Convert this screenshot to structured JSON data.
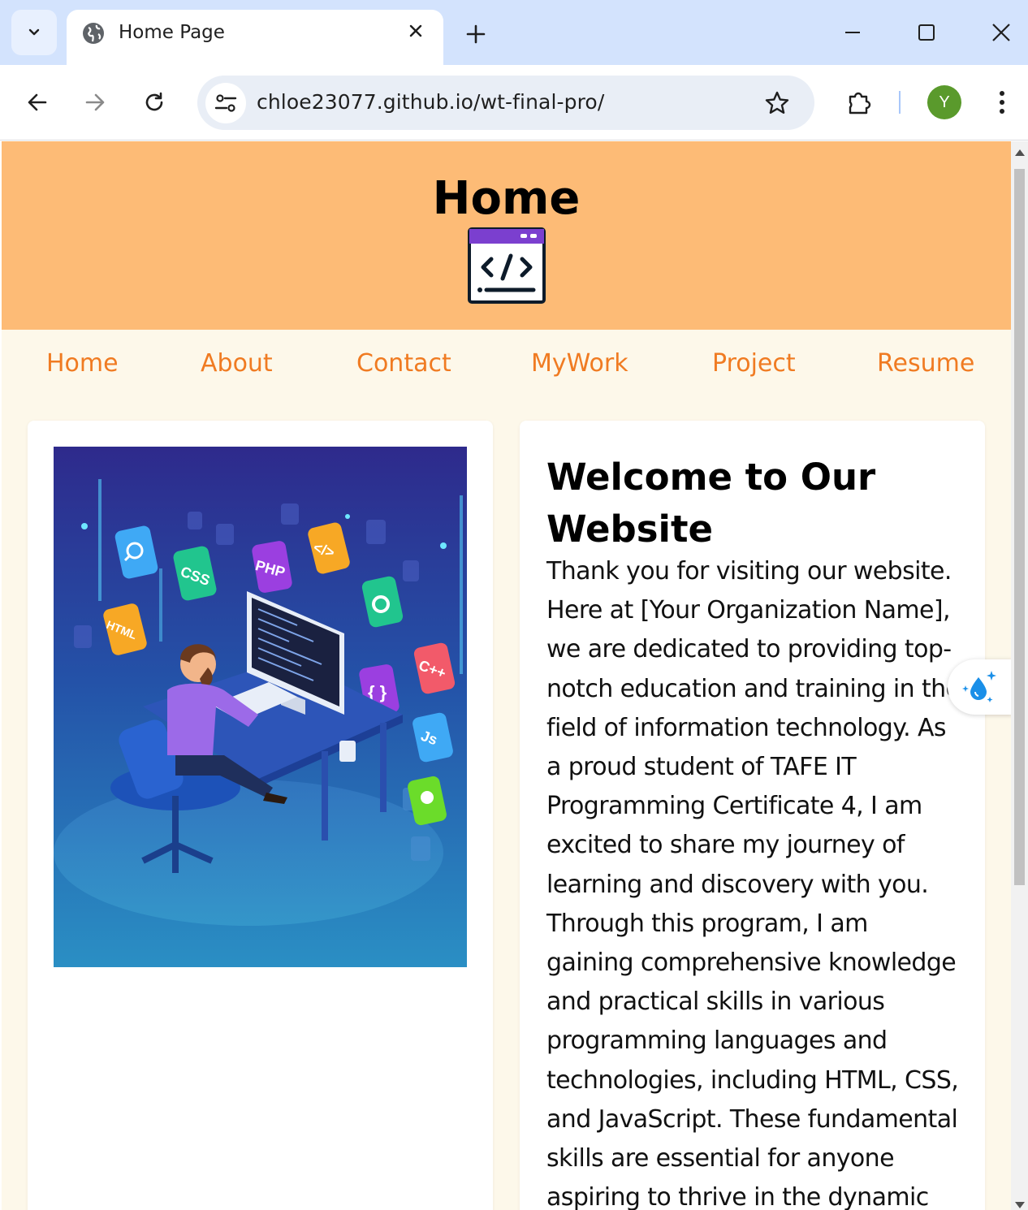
{
  "browser": {
    "tab_title": "Home Page",
    "url": "chloe23077.github.io/wt-final-pro/",
    "avatar_letter": "Y"
  },
  "header": {
    "title": "Home",
    "logo_icon": "code-window-icon"
  },
  "nav": {
    "items": [
      {
        "label": "Home"
      },
      {
        "label": "About"
      },
      {
        "label": "Contact"
      },
      {
        "label": "MyWork"
      },
      {
        "label": "Project"
      },
      {
        "label": "Resume"
      }
    ]
  },
  "main": {
    "hero_image": "developer-at-computer-illustration",
    "welcome_title": "Welcome to Our Website",
    "welcome_text": "Thank you for visiting our website. Here at [Your Organization Name], we are dedicated to providing top-notch education and training in the field of information technology. As a proud student of TAFE IT Programming Certificate 4, I am excited to share my journey of learning and discovery with you. Through this program, I am gaining comprehensive knowledge and practical skills in various programming languages and technologies, including HTML, CSS, and JavaScript. These fundamental skills are essential for anyone aspiring to thrive in the dynamic"
  },
  "colors": {
    "header_bg": "#fdbb76",
    "page_bg": "#fdf8ea",
    "nav_link": "#f07b22",
    "logo_accent": "#7b3fcf"
  }
}
